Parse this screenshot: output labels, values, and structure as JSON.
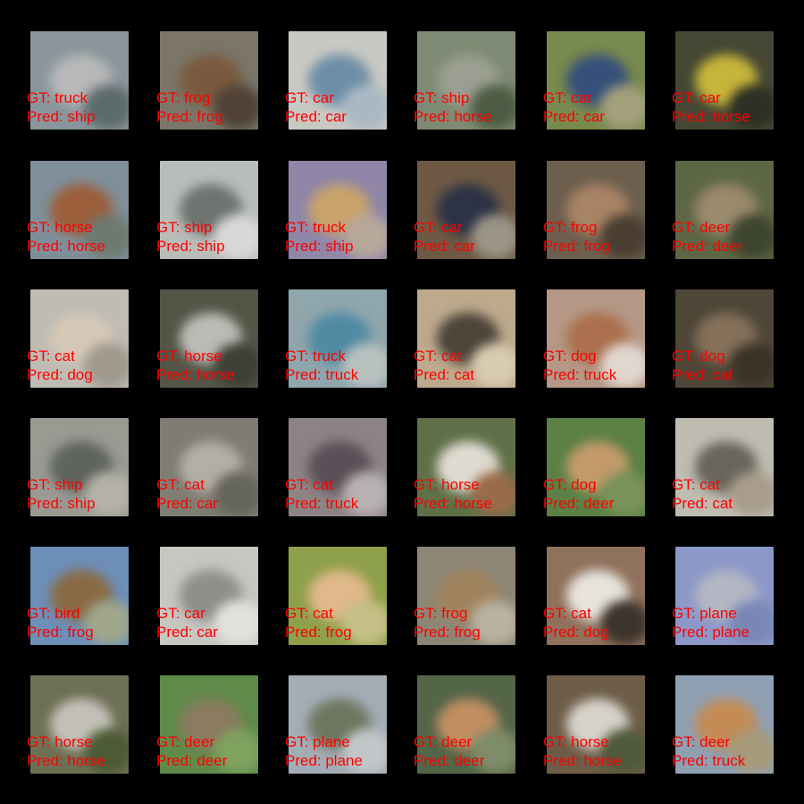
{
  "label_color": "#ff0000",
  "gt_prefix": "GT: ",
  "pred_prefix": "Pred: ",
  "grid": {
    "rows": [
      [
        {
          "gt": "truck",
          "pred": "ship",
          "bg": "#8a969c",
          "fg": "#b8b8b8",
          "fg2": "#5d6a6b"
        },
        {
          "gt": "frog",
          "pred": "frog",
          "bg": "#7b7669",
          "fg": "#7a5a3e",
          "fg2": "#4f4236"
        },
        {
          "gt": "car",
          "pred": "car",
          "bg": "#c9c9c3",
          "fg": "#6d8ea8",
          "fg2": "#a9b8c4"
        },
        {
          "gt": "ship",
          "pred": "horse",
          "bg": "#7e8a73",
          "fg": "#9b9f91",
          "fg2": "#4d5c44"
        },
        {
          "gt": "car",
          "pred": "car",
          "bg": "#788a4d",
          "fg": "#37507b",
          "fg2": "#a3a07b"
        },
        {
          "gt": "car",
          "pred": "horse",
          "bg": "#454734",
          "fg": "#c7b53b",
          "fg2": "#2f3024"
        }
      ],
      [
        {
          "gt": "horse",
          "pred": "horse",
          "bg": "#7f8f9a",
          "fg": "#9c5e3a",
          "fg2": "#6d7a6f"
        },
        {
          "gt": "ship",
          "pred": "ship",
          "bg": "#b9bdba",
          "fg": "#6f736f",
          "fg2": "#d7d9d6"
        },
        {
          "gt": "truck",
          "pred": "ship",
          "bg": "#8f86a8",
          "fg": "#c9a36b",
          "fg2": "#b7a89a"
        },
        {
          "gt": "car",
          "pred": "car",
          "bg": "#6e5a44",
          "fg": "#2d3345",
          "fg2": "#9a9587"
        },
        {
          "gt": "frog",
          "pred": "frog",
          "bg": "#6d5f4d",
          "fg": "#a88465",
          "fg2": "#4a3e31"
        },
        {
          "gt": "deer",
          "pred": "deer",
          "bg": "#5e6745",
          "fg": "#9b8a6c",
          "fg2": "#3e452f"
        }
      ],
      [
        {
          "gt": "cat",
          "pred": "dog",
          "bg": "#bfbcb4",
          "fg": "#d6c8b6",
          "fg2": "#9f998e"
        },
        {
          "gt": "horse",
          "pred": "horse",
          "bg": "#545547",
          "fg": "#bcbcb7",
          "fg2": "#3e4036"
        },
        {
          "gt": "truck",
          "pred": "truck",
          "bg": "#8fa6ad",
          "fg": "#4f8aa3",
          "fg2": "#b9c1bf"
        },
        {
          "gt": "cat",
          "pred": "cat",
          "bg": "#bda98c",
          "fg": "#4d443a",
          "fg2": "#d8cbb0"
        },
        {
          "gt": "dog",
          "pred": "truck",
          "bg": "#b59886",
          "fg": "#ab6f4e",
          "fg2": "#e0d7cf"
        },
        {
          "gt": "dog",
          "pred": "cat",
          "bg": "#4e4637",
          "fg": "#85705a",
          "fg2": "#3a3428"
        }
      ],
      [
        {
          "gt": "ship",
          "pred": "ship",
          "bg": "#9a9a93",
          "fg": "#5f645e",
          "fg2": "#b3b1a8"
        },
        {
          "gt": "cat",
          "pred": "car",
          "bg": "#7f7d73",
          "fg": "#b2afa4",
          "fg2": "#66655c"
        },
        {
          "gt": "cat",
          "pred": "truck",
          "bg": "#8d8384",
          "fg": "#5a5057",
          "fg2": "#b8b1b1"
        },
        {
          "gt": "horse",
          "pred": "horse",
          "bg": "#5f7048",
          "fg": "#e0dbd2",
          "fg2": "#9a6a4a"
        },
        {
          "gt": "dog",
          "pred": "deer",
          "bg": "#5c8045",
          "fg": "#c49a6a",
          "fg2": "#79925a"
        },
        {
          "gt": "cat",
          "pred": "cat",
          "bg": "#bfbcb2",
          "fg": "#6a655c",
          "fg2": "#a89c8a"
        }
      ],
      [
        {
          "gt": "bird",
          "pred": "frog",
          "bg": "#6d8fb8",
          "fg": "#8a6a45",
          "fg2": "#a0a78a"
        },
        {
          "gt": "car",
          "pred": "car",
          "bg": "#c7c6c1",
          "fg": "#8e8f8a",
          "fg2": "#e2e1dd"
        },
        {
          "gt": "cat",
          "pred": "frog",
          "bg": "#8fa04a",
          "fg": "#e0b88a",
          "fg2": "#c6c088"
        },
        {
          "gt": "frog",
          "pred": "frog",
          "bg": "#8e8675",
          "fg": "#a1845f",
          "fg2": "#bab29f"
        },
        {
          "gt": "cat",
          "pred": "dog",
          "bg": "#8f715c",
          "fg": "#e7e3dd",
          "fg2": "#3d342c"
        },
        {
          "gt": "plane",
          "pred": "plane",
          "bg": "#8c98c8",
          "fg": "#b3b6c3",
          "fg2": "#7987b6"
        }
      ],
      [
        {
          "gt": "horse",
          "pred": "horse",
          "bg": "#6e7055",
          "fg": "#c4c1b9",
          "fg2": "#4c5a35"
        },
        {
          "gt": "deer",
          "pred": "deer",
          "bg": "#5f8a4a",
          "fg": "#8b7b5f",
          "fg2": "#7fa25f"
        },
        {
          "gt": "plane",
          "pred": "plane",
          "bg": "#a3adb5",
          "fg": "#6f7660",
          "fg2": "#c3c6c8"
        },
        {
          "gt": "deer",
          "pred": "deer",
          "bg": "#546648",
          "fg": "#c18e62",
          "fg2": "#7f8c6a"
        },
        {
          "gt": "horse",
          "pred": "horse",
          "bg": "#6d5d48",
          "fg": "#d7d2ca",
          "fg2": "#4f5a3a"
        },
        {
          "gt": "deer",
          "pred": "truck",
          "bg": "#8fa0b3",
          "fg": "#c48b56",
          "fg2": "#a79a7a"
        }
      ]
    ]
  }
}
